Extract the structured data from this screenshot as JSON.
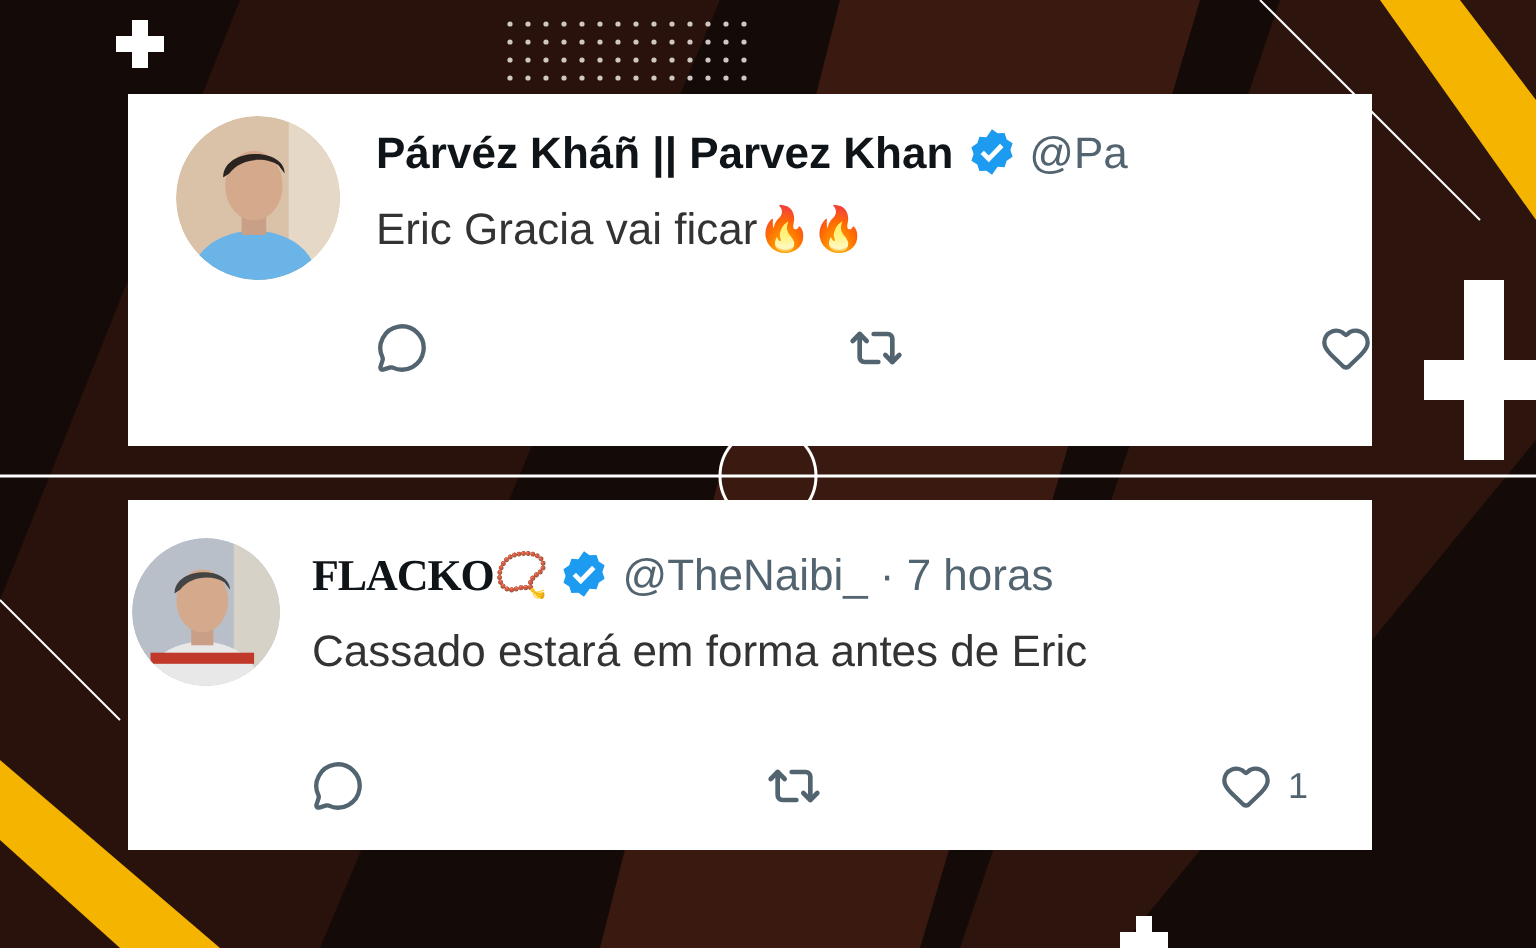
{
  "posts": [
    {
      "kind": "plain",
      "display_name": "Párvéz Kháñ || Parvez Khan",
      "verified": true,
      "handle": "@Pa",
      "text": "Eric Gracia vai ficar🔥🔥",
      "actions": [
        {
          "kind": "reply"
        },
        {
          "kind": "repost"
        },
        {
          "kind": "like"
        }
      ]
    },
    {
      "kind": "stylized",
      "display_name": "FLACKO📿",
      "verified": true,
      "handle": "@TheNaibi_",
      "time": "· 7 horas",
      "text": "Cassado estará em forma antes de Eric",
      "actions": [
        {
          "kind": "reply"
        },
        {
          "kind": "repost"
        },
        {
          "kind": "like",
          "count": "1"
        }
      ]
    }
  ]
}
